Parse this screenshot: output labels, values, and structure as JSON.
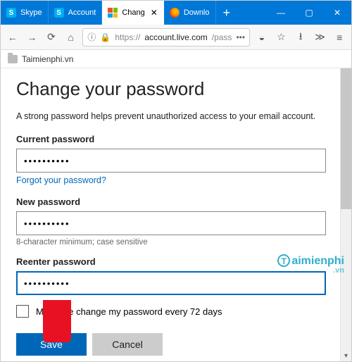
{
  "tabs": [
    {
      "label": "Skype",
      "icon": "skype"
    },
    {
      "label": "Account",
      "icon": "skype"
    },
    {
      "label": "Chang",
      "icon": "ms",
      "active": true
    },
    {
      "label": "Downlo",
      "icon": "ff"
    }
  ],
  "window": {
    "min": "—",
    "max": "▢",
    "close": "✕"
  },
  "toolbar": {
    "info": "ⓘ",
    "url_prefix": "https://",
    "url_host": "account.live.com",
    "url_path": "/pass",
    "more": "•••"
  },
  "bookmarks": {
    "item1": "Taimienphi.vn"
  },
  "page": {
    "heading": "Change your password",
    "subtitle": "A strong password helps prevent unauthorized access to your email account.",
    "current_label": "Current password",
    "current_value": "••••••••••",
    "forgot": "Forgot your password?",
    "new_label": "New password",
    "new_value": "••••••••••",
    "hint": "8-character minimum; case sensitive",
    "reenter_label": "Reenter password",
    "reenter_value": "••••••••••",
    "checkbox_label": "Make me change my password every 72 days",
    "save": "Save",
    "cancel": "Cancel"
  },
  "watermark": {
    "t": "T",
    "text": "aimienphi",
    "vn": ".vn"
  }
}
